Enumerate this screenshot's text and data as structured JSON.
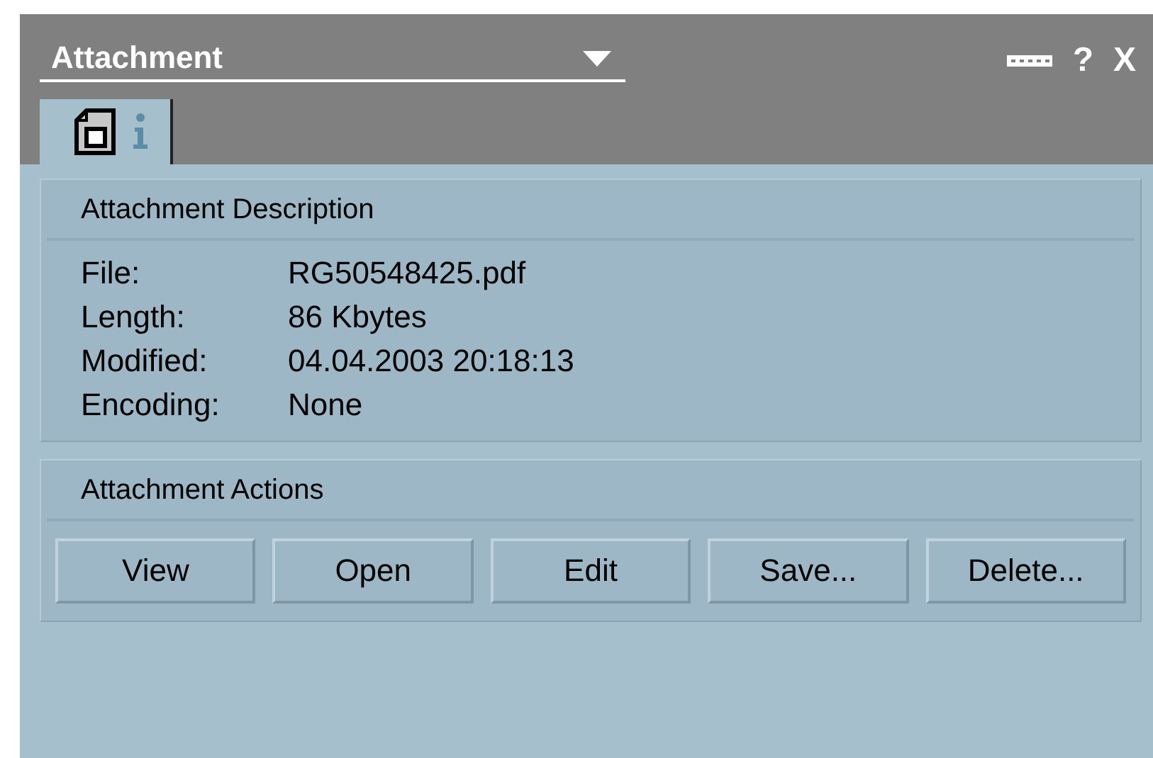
{
  "panel": {
    "title": "Attachment",
    "help": "?",
    "close": "X"
  },
  "tabs": [
    {
      "selected": true
    }
  ],
  "description": {
    "heading": "Attachment Description",
    "fields": [
      {
        "label": "File:",
        "value": "RG50548425.pdf"
      },
      {
        "label": "Length:",
        "value": "86 Kbytes"
      },
      {
        "label": "Modified:",
        "value": "04.04.2003 20:18:13"
      },
      {
        "label": "Encoding:",
        "value": "None"
      }
    ]
  },
  "actions": {
    "heading": "Attachment Actions",
    "buttons": [
      "View",
      "Open",
      "Edit",
      "Save...",
      "Delete..."
    ]
  }
}
